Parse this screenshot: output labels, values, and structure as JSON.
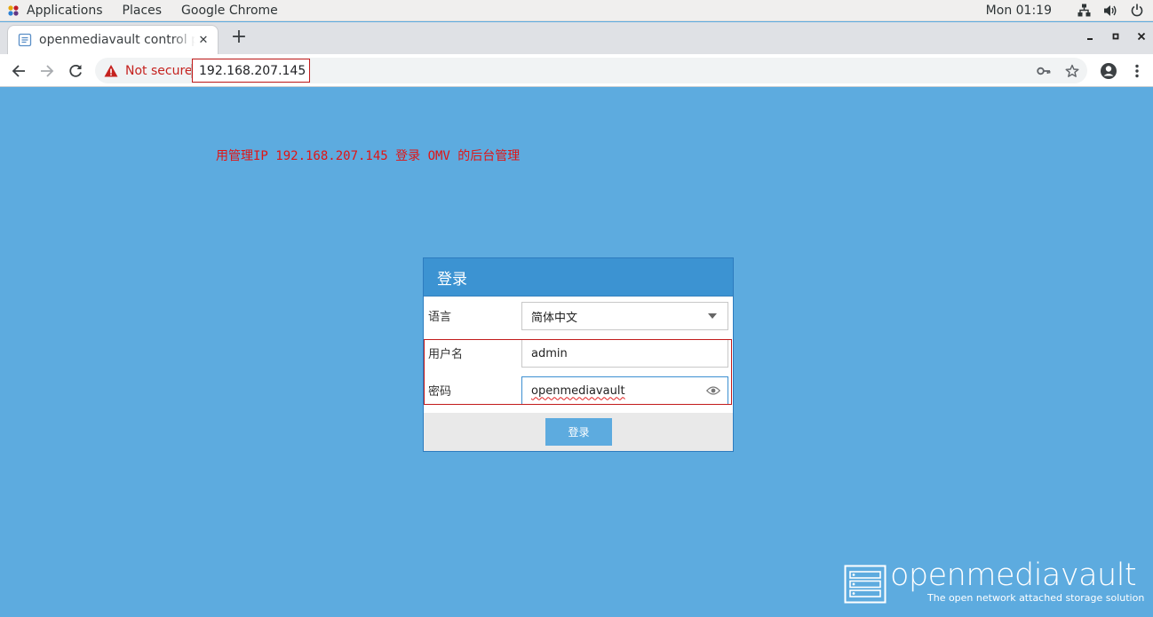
{
  "system_bar": {
    "applications": "Applications",
    "places": "Places",
    "app_name": "Google Chrome",
    "clock": "Mon 01:19",
    "icons": [
      "network-icon",
      "volume-icon",
      "power-icon"
    ]
  },
  "browser": {
    "tab": {
      "title": "openmediavault control panel",
      "favicon": "page-icon"
    },
    "new_tab_label": "+",
    "window_controls": [
      "minimize",
      "maximize",
      "close"
    ],
    "security_label": "Not secure",
    "url": "192.168.207.145",
    "icons": [
      "back-icon",
      "forward-icon",
      "reload-icon",
      "key-icon",
      "star-icon",
      "account-icon",
      "menu-icon"
    ]
  },
  "annotation": "用管理IP 192.168.207.145 登录 OMV 的后台管理",
  "login": {
    "title": "登录",
    "language_label": "语言",
    "language_value": "简体中文",
    "username_label": "用户名",
    "username_value": "admin",
    "password_label": "密码",
    "password_value": "openmediavault",
    "submit_label": "登录"
  },
  "brand": {
    "name": "openmediavault",
    "tagline": "The open network attached storage solution"
  },
  "colors": {
    "page_bg": "#5dabdf",
    "panel_header": "#3c93d2",
    "annotation": "#e11414",
    "not_secure": "#c5221f"
  }
}
